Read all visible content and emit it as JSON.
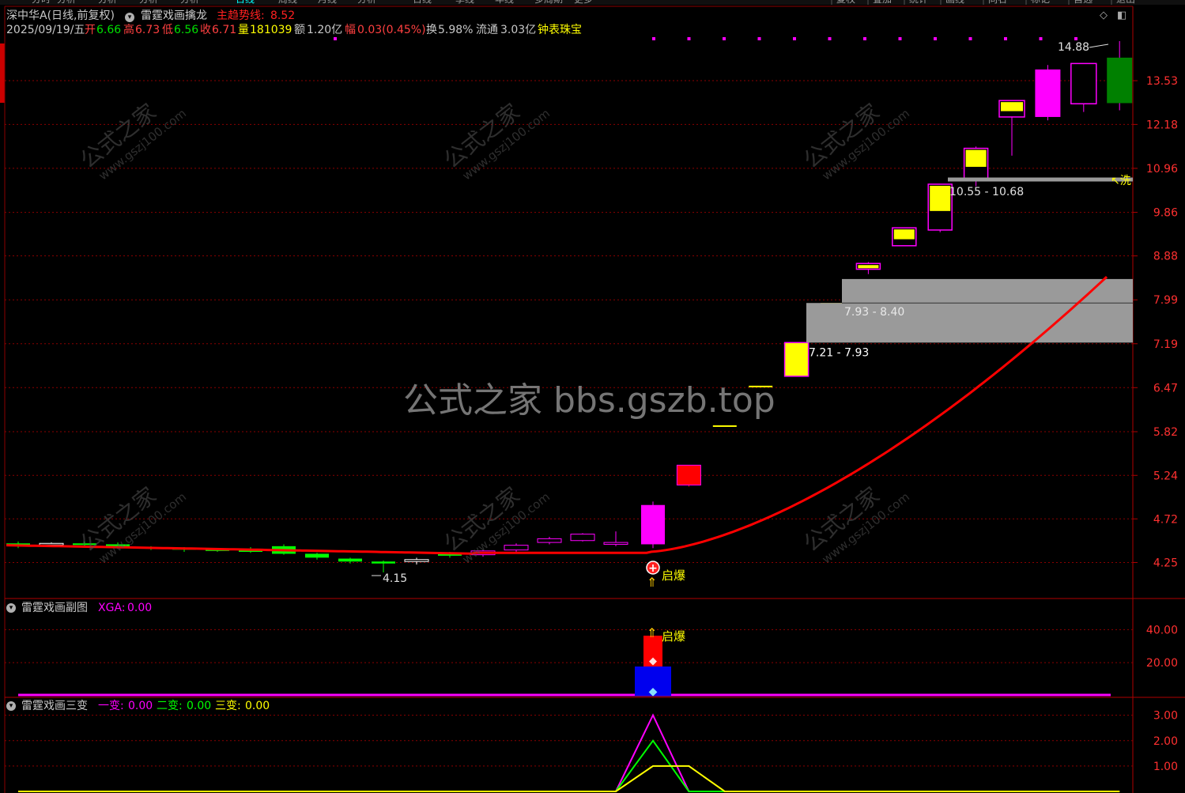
{
  "menu_tabs": [
    "分时",
    "分析",
    "分析",
    "分析",
    "分析",
    "日线",
    "周线",
    "月线",
    "分析",
    "日线",
    "季线",
    "年线",
    "多周期",
    "更多"
  ],
  "right_tabs": [
    "复权",
    "叠加",
    "统计",
    "画线",
    "同名",
    "标记",
    "自选",
    "退出"
  ],
  "header": {
    "stock": "深中华A(日线,前复权)",
    "indicator": "雷霆戏画擒龙",
    "trend_label": "主趋势线:",
    "trend_value": "8.52",
    "date": "2025/09/19/五",
    "open_label": "开",
    "open": "6.66",
    "high_label": "高",
    "high": "6.73",
    "low_label": "低",
    "low": "6.56",
    "close_label": "收",
    "close": "6.71",
    "vol_label": "量",
    "vol": "181039",
    "amt_label": "额",
    "amt": "1.20亿",
    "chg_label": "幅",
    "chg": "0.03(0.45%)",
    "turn_label": "换",
    "turn": "5.98%",
    "float_label": "流通",
    "float": "3.03亿",
    "sector": "钟表珠宝"
  },
  "price_axis": [
    "13.53",
    "12.18",
    "10.96",
    "9.86",
    "8.88",
    "7.99",
    "7.19",
    "6.47",
    "5.82",
    "5.24",
    "4.72",
    "4.25"
  ],
  "annotations": {
    "high": "14.88",
    "low": "4.15",
    "zone_top": "10.55 - 10.68",
    "zone_mid": "7.93 - 8.40",
    "zone_low": "7.21 - 7.93",
    "qibao": "启爆",
    "xi": "洗"
  },
  "sub1": {
    "title": "雷霆戏画副图",
    "xga_label": "XGA:",
    "xga": "0.00",
    "axis": [
      "40.00",
      "20.00"
    ],
    "qibao": "启爆"
  },
  "sub2": {
    "title": "雷霆戏画三变",
    "a_label": "一变:",
    "a": "0.00",
    "b_label": "二变:",
    "b": "0.00",
    "c_label": "三变:",
    "c": "0.00",
    "axis": [
      "3.00",
      "2.00",
      "1.00"
    ]
  },
  "watermark": {
    "main": "公式之家 bbs.gszb.top",
    "seal": "公式之家",
    "seal_url": "www.gszj100.com"
  },
  "colors": {
    "up": "#ff00ff",
    "up_small": "#ffff00",
    "down": "#00ff00",
    "down_big": "#008000",
    "trend": "#ff0000",
    "grid": "#8b0000",
    "zone": "#9a9a9a"
  },
  "chart_data": {
    "type": "candlestick",
    "ylim": [
      4.0,
      15.2
    ],
    "log_scale": true,
    "candles": [
      {
        "o": 4.45,
        "h": 4.47,
        "l": 4.4,
        "c": 4.43
      },
      {
        "o": 4.44,
        "h": 4.46,
        "l": 4.41,
        "c": 4.45
      },
      {
        "o": 4.45,
        "h": 4.47,
        "l": 4.42,
        "c": 4.44
      },
      {
        "o": 4.44,
        "h": 4.46,
        "l": 4.4,
        "c": 4.41
      },
      {
        "o": 4.41,
        "h": 4.42,
        "l": 4.38,
        "c": 4.4
      },
      {
        "o": 4.4,
        "h": 4.41,
        "l": 4.36,
        "c": 4.39
      },
      {
        "o": 4.39,
        "h": 4.4,
        "l": 4.36,
        "c": 4.37
      },
      {
        "o": 4.38,
        "h": 4.41,
        "l": 4.35,
        "c": 4.36
      },
      {
        "o": 4.42,
        "h": 4.44,
        "l": 4.33,
        "c": 4.34
      },
      {
        "o": 4.34,
        "h": 4.35,
        "l": 4.28,
        "c": 4.3
      },
      {
        "o": 4.29,
        "h": 4.3,
        "l": 4.24,
        "c": 4.26
      },
      {
        "o": 4.26,
        "h": 4.27,
        "l": 4.15,
        "c": 4.24
      },
      {
        "o": 4.26,
        "h": 4.3,
        "l": 4.23,
        "c": 4.28
      },
      {
        "o": 4.34,
        "h": 4.36,
        "l": 4.3,
        "c": 4.32
      },
      {
        "o": 4.33,
        "h": 4.38,
        "l": 4.31,
        "c": 4.37
      },
      {
        "o": 4.38,
        "h": 4.45,
        "l": 4.36,
        "c": 4.43
      },
      {
        "o": 4.46,
        "h": 4.52,
        "l": 4.44,
        "c": 4.5
      },
      {
        "o": 4.48,
        "h": 4.56,
        "l": 4.47,
        "c": 4.55
      },
      {
        "o": 4.44,
        "h": 4.58,
        "l": 4.42,
        "c": 4.46
      },
      {
        "o": 4.44,
        "h": 4.92,
        "l": 4.4,
        "c": 4.88
      },
      {
        "o": 5.12,
        "h": 5.37,
        "l": 5.1,
        "c": 5.37
      },
      {
        "o": 5.91,
        "h": 5.91,
        "l": 5.91,
        "c": 5.91
      },
      {
        "o": 6.5,
        "h": 6.5,
        "l": 6.5,
        "c": 6.5
      },
      {
        "o": 6.65,
        "h": 7.21,
        "l": 6.65,
        "c": 7.21
      },
      {
        "o": 7.93,
        "h": 7.93,
        "l": 7.93,
        "c": 7.93
      },
      {
        "o": 8.6,
        "h": 8.75,
        "l": 8.5,
        "c": 8.72
      },
      {
        "o": 9.1,
        "h": 9.5,
        "l": 9.1,
        "c": 9.5
      },
      {
        "o": 9.45,
        "h": 10.55,
        "l": 9.4,
        "c": 10.55
      },
      {
        "o": 10.68,
        "h": 11.55,
        "l": 10.5,
        "c": 11.5
      },
      {
        "o": 12.4,
        "h": 12.9,
        "l": 11.3,
        "c": 12.9
      },
      {
        "o": 12.4,
        "h": 14.05,
        "l": 12.3,
        "c": 13.9
      },
      {
        "o": 12.8,
        "h": 14.1,
        "l": 12.55,
        "c": 14.1
      },
      {
        "o": 14.3,
        "h": 14.88,
        "l": 12.6,
        "c": 12.82
      }
    ],
    "xga": [
      0,
      0,
      0,
      0,
      0,
      0,
      0,
      0,
      0,
      0,
      0,
      0,
      0,
      0,
      0,
      0,
      0,
      0,
      0,
      50,
      0,
      0,
      0,
      0,
      0,
      0,
      0,
      0,
      0,
      0,
      0,
      0,
      0
    ],
    "variant": {
      "one": [
        0,
        0,
        0,
        0,
        0,
        0,
        0,
        0,
        0,
        0,
        0,
        0,
        0,
        0,
        0,
        0,
        0,
        0,
        0,
        3,
        0,
        0,
        0,
        0,
        0,
        0,
        0,
        0,
        0,
        0,
        0,
        0,
        0
      ],
      "two": [
        0,
        0,
        0,
        0,
        0,
        0,
        0,
        0,
        0,
        0,
        0,
        0,
        0,
        0,
        0,
        0,
        0,
        0,
        0,
        2,
        0,
        0,
        0,
        0,
        0,
        0,
        0,
        0,
        0,
        0,
        0,
        0,
        0
      ],
      "three": [
        0,
        0,
        0,
        0,
        0,
        0,
        0,
        0,
        0,
        0,
        0,
        0,
        0,
        0,
        0,
        0,
        0,
        0,
        0,
        1,
        1,
        0,
        0,
        0,
        0,
        0,
        0,
        0,
        0,
        0,
        0,
        0,
        0
      ]
    }
  }
}
